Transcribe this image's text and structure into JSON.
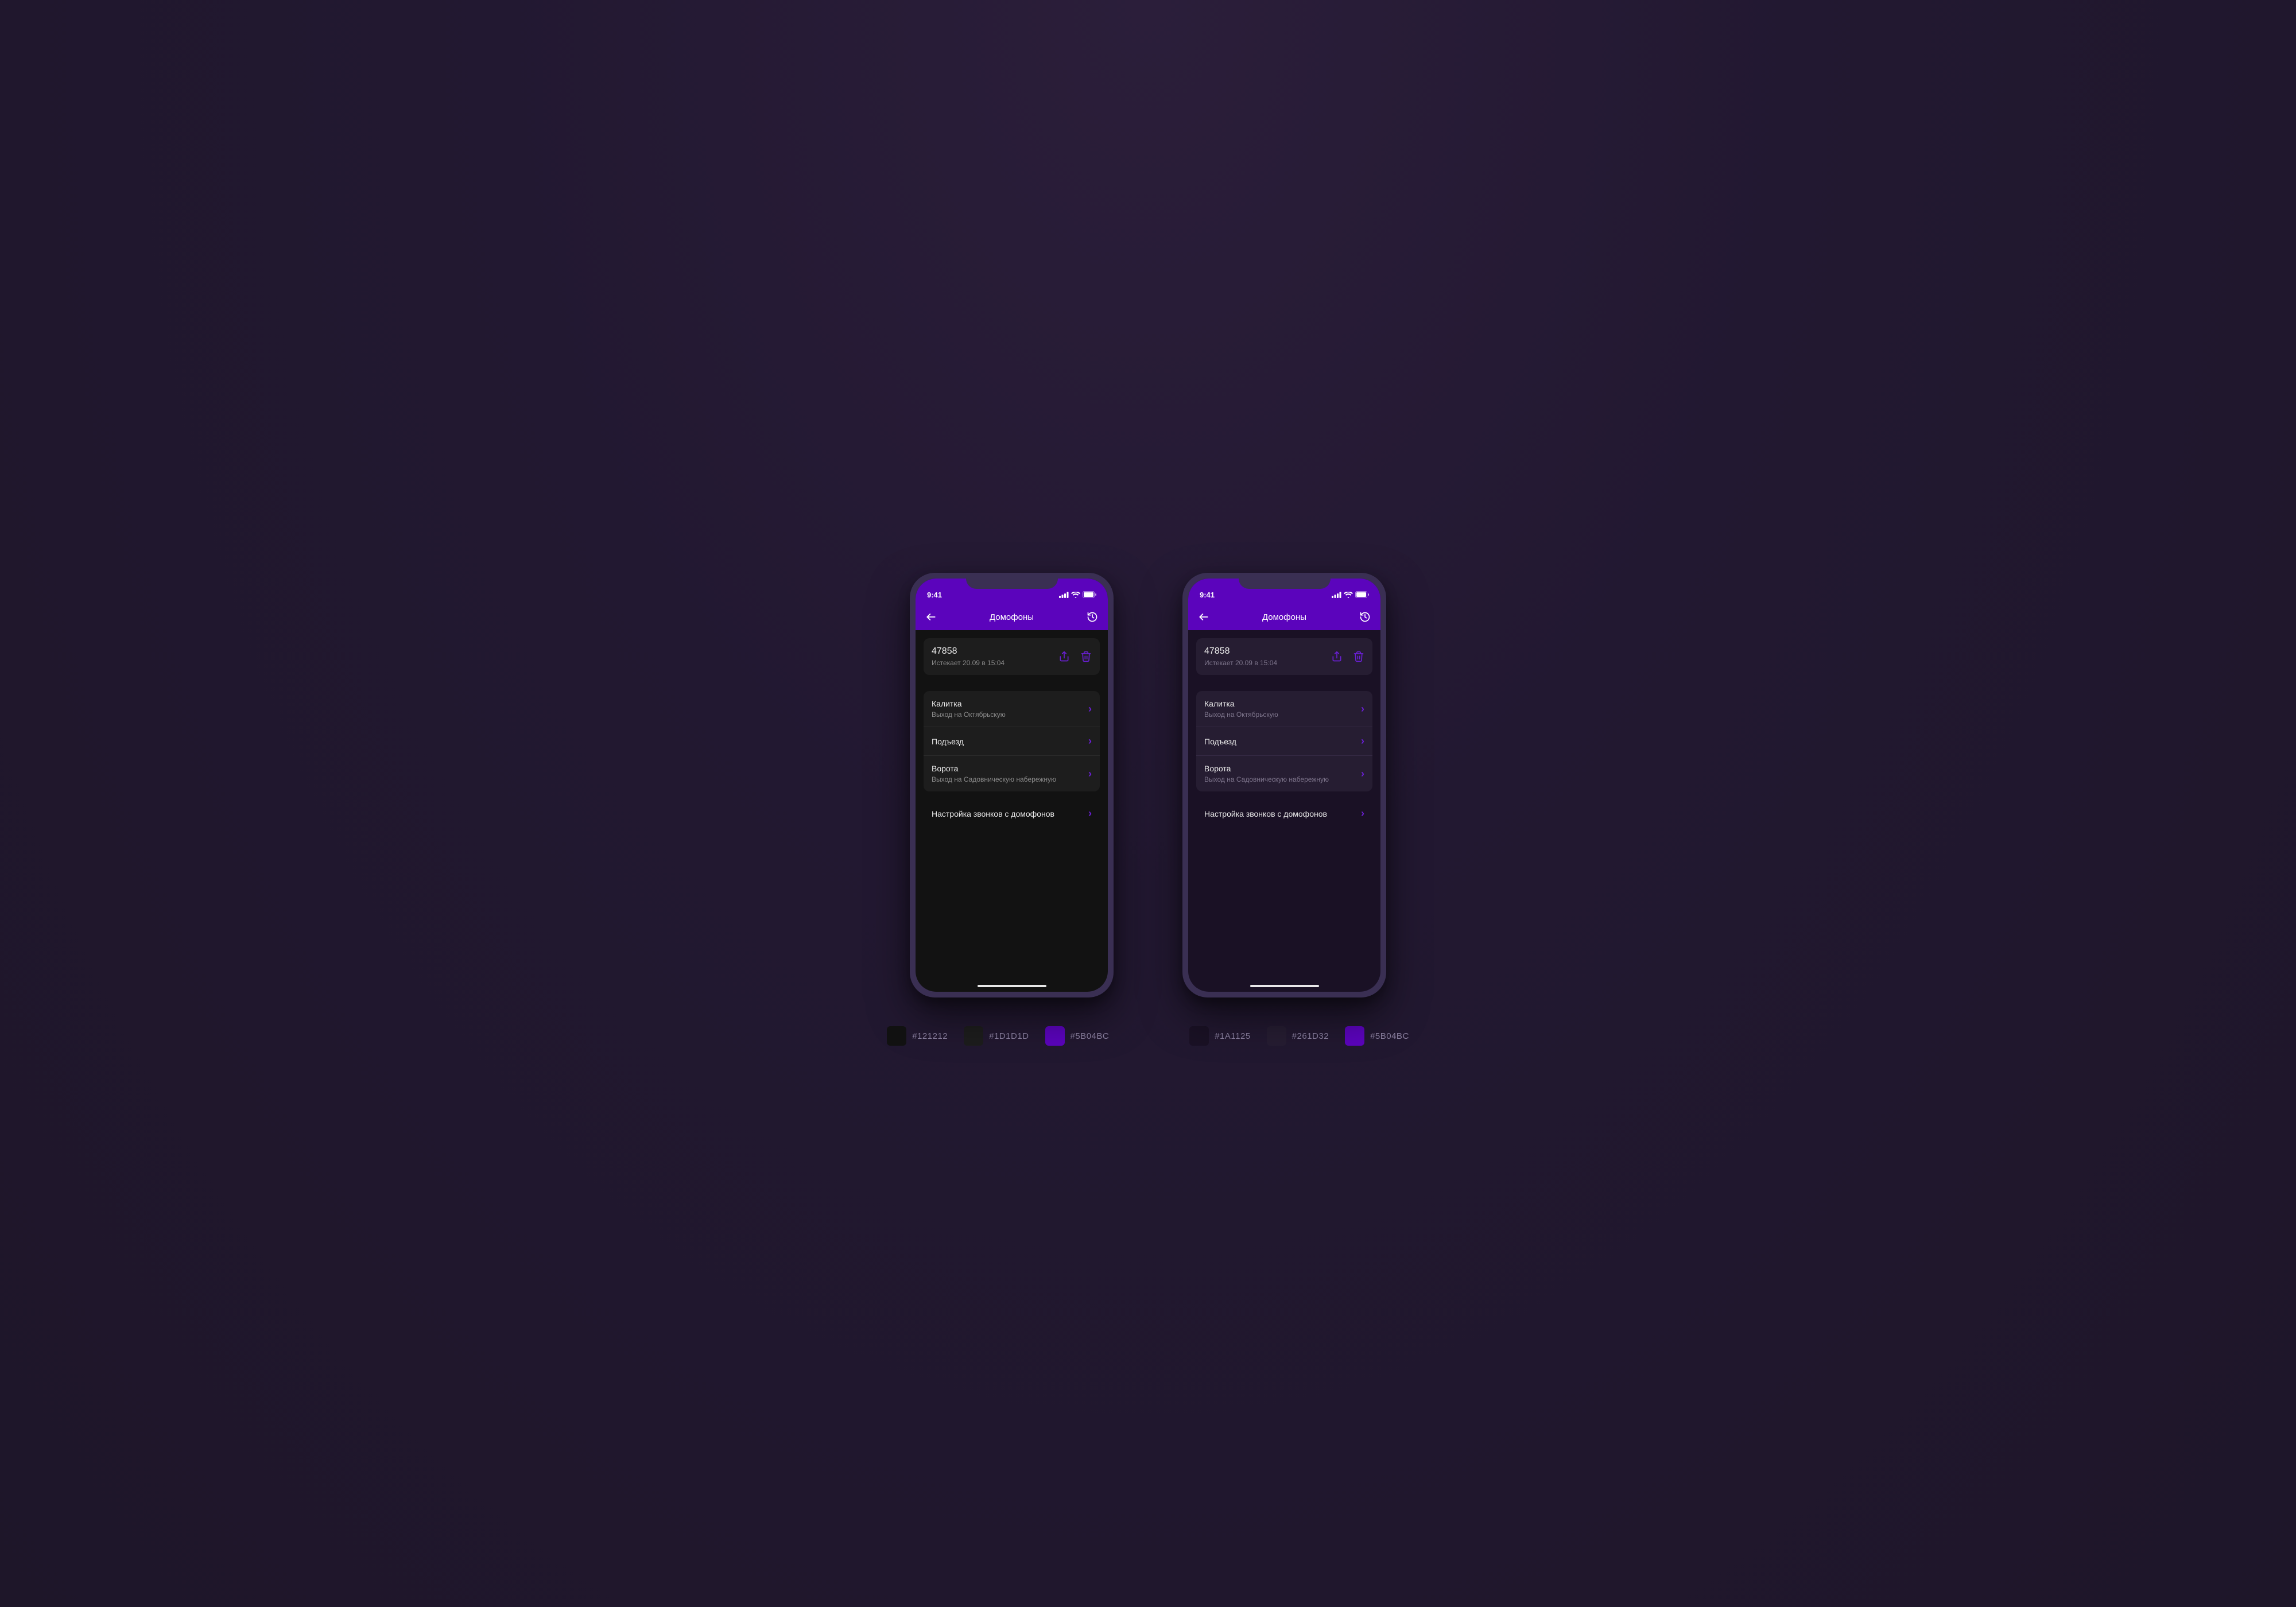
{
  "status": {
    "time": "9:41"
  },
  "header": {
    "title": "Домофоны"
  },
  "code": {
    "value": "47858",
    "expiry": "Истекает 20.09 в 15:04"
  },
  "items": [
    {
      "title": "Калитка",
      "sub": "Выход на Октябрьскую"
    },
    {
      "title": "Подъезд"
    },
    {
      "title": "Ворота",
      "sub": "Выход на Садовническую набережную"
    }
  ],
  "settings_label": "Настройка звонков с домофонов",
  "palettes": {
    "dark": [
      {
        "hex": "#121212"
      },
      {
        "hex": "#1D1D1D"
      },
      {
        "hex": "#5B04BC"
      }
    ],
    "purple": [
      {
        "hex": "#1A1125"
      },
      {
        "hex": "#261D32"
      },
      {
        "hex": "#5B04BC"
      }
    ]
  }
}
